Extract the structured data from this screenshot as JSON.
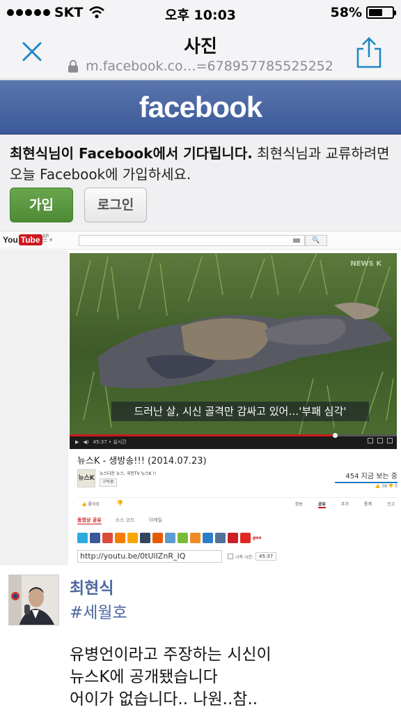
{
  "status_bar": {
    "carrier": "SKT",
    "time": "오후 10:03",
    "battery_text": "58%",
    "battery_level": 0.58,
    "icons": [
      "signal-dots-icon",
      "wifi-icon",
      "battery-icon"
    ]
  },
  "nav": {
    "title": "사진",
    "url": "m.facebook.co…=678957785525252",
    "icons": [
      "close-icon",
      "lock-icon",
      "share-icon"
    ]
  },
  "facebook": {
    "logo": "facebook",
    "promo_bold": "최현식님이 Facebook에서 기다립니다.",
    "promo_text": " 최현식님과 교류하려면 오늘 Facebook에 가입하세요.",
    "join_button": "가입",
    "login_button": "로그인"
  },
  "youtube": {
    "logo_you": "You",
    "logo_tube": "Tube",
    "logo_region": "KR",
    "search_button": "🔍",
    "video_caption": "드러난 살, 시신 골격만 감싸고 있어…'부패 심각'",
    "watermark": "NEWS K",
    "time": "45:37 • 실시간",
    "progress": 0.81,
    "video_title": "뉴스K - 생방송!!! (2014.07.23)",
    "channel_thumb": "뉴스K",
    "channel_name": "뉴스다운 뉴스, 국민TV 뉴스K !!",
    "subscribe": "구독중",
    "views": "454 지금 보는 중",
    "likes": "👍 38  👎 0",
    "like_label": "좋아요",
    "action_tabs": [
      "정보",
      "공유",
      "추가",
      "통계",
      "신고"
    ],
    "share_tabs": [
      "동영상 공유",
      "소스 코드",
      "이메일"
    ],
    "share_url": "http://youtu.be/0tUlIZnR_IQ",
    "start_label": "시작 시간:",
    "start_time": "45:37",
    "social_colors": [
      "#2daae1",
      "#3b5998",
      "#dd4b39",
      "#f57d00",
      "#f8a700",
      "#35465c",
      "#e65a00",
      "#5f99cf",
      "#7aba3a",
      "#f08a24",
      "#2a7ecc",
      "#507299",
      "#cb2027",
      "#e02a20"
    ],
    "goo": "goo"
  },
  "post": {
    "author": "최현식",
    "hashtag": "#세월호",
    "lines": [
      "유병언이라고 주장하는 시신이",
      "뉴스K에 공개됐습니다",
      "어이가 없습니다.. 나원..참.."
    ]
  },
  "colors": {
    "facebook_blue": "#3b5998",
    "join_green": "#4e8a35",
    "link_blue": "#4b67a1",
    "ios_blue": "#1f86c8",
    "youtube_red": "#cc181e"
  }
}
